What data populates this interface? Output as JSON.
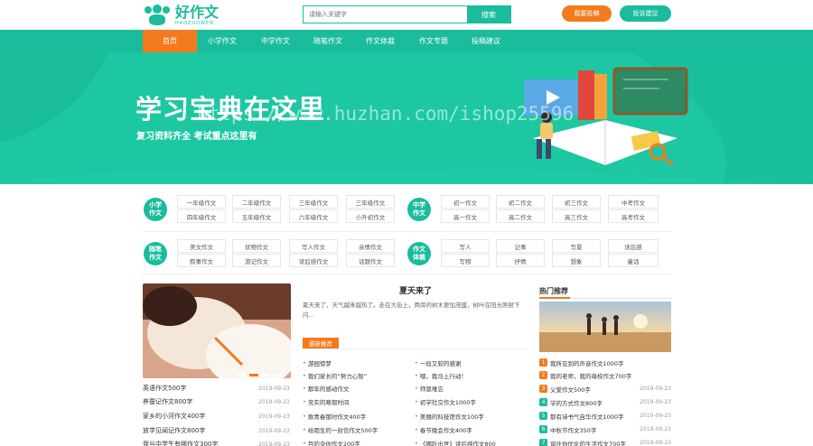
{
  "header": {
    "logo_cn": "好作文",
    "logo_en": "HAOZUOWEN",
    "search_placeholder": "请输入关键字",
    "search_button": "搜索",
    "submit_button": "我要投稿",
    "suggest_button": "投诉建议"
  },
  "nav": [
    "首页",
    "小学作文",
    "中学作文",
    "随笔作文",
    "作文体裁",
    "作文专题",
    "投稿建议"
  ],
  "banner": {
    "title": "学习宝典在这里",
    "subtitle": "复习资料齐全 考试重点这里有",
    "watermark": "https://www.huzhan.com/ishop25596"
  },
  "categories": {
    "primary": {
      "badge": "小学作文",
      "items": [
        "一年级作文",
        "二年级作文",
        "三年级作文",
        "三年级作文",
        "四年级作文",
        "五年级作文",
        "六年级作文",
        "小升初作文"
      ]
    },
    "middle": {
      "badge": "中学作文",
      "items": [
        "初一作文",
        "初二作文",
        "初三作文",
        "中考作文",
        "高一作文",
        "高二作文",
        "高三作文",
        "高考作文"
      ]
    },
    "essay": {
      "badge": "随笔作文",
      "items": [
        "美文作文",
        "状物作文",
        "写人作文",
        "亲情作文",
        "叙事作文",
        "游记作文",
        "读后感作文",
        "话题作文"
      ]
    },
    "genre": {
      "badge": "作文体裁",
      "items": [
        "写人",
        "记事",
        "写景",
        "读后感",
        "写物",
        "抒情",
        "想象",
        "童话"
      ]
    }
  },
  "left_list": [
    {
      "title": "英语作文500字",
      "date": "2019-09-23"
    },
    {
      "title": "养蚕记作文800字",
      "date": "2019-09-23"
    },
    {
      "title": "家乡的小河作文400字",
      "date": "2019-09-23"
    },
    {
      "title": "放学见闻记作文800字",
      "date": "2019-09-23"
    },
    {
      "title": "我与中学生有哪作文300字",
      "date": "2019-09-23"
    }
  ],
  "featured": {
    "title": "夏天来了",
    "desc": "夏天来了，天气越来越热了。走在大街上，两旁的树木更加茂盛，树叶在阳光照射下闪..."
  },
  "latest": {
    "tag": "最新推荐",
    "col1": [
      "游园惊梦",
      "我们家长的“努力心智”",
      "那年的感动作文",
      "充实的寒假时间",
      "致青春那时作文400字",
      "给陌生的一封信作文500字",
      "目的令你作文200字"
    ],
    "col2": [
      "一段又软的感谢",
      "嘿，我马上行动！",
      "师恩难忘",
      "初学社交作文1000字",
      "美丽的科技馆作文100字",
      "春节晚会作文400字",
      "《哪吒出世》读后感作文800"
    ]
  },
  "hot": {
    "title": "热门推荐",
    "items": [
      {
        "num": "1",
        "title": "我所见到的声音作文1000字",
        "date": ""
      },
      {
        "num": "2",
        "title": "我的老师，我的母校作文700字",
        "date": ""
      },
      {
        "num": "3",
        "title": "父爱作文500字",
        "date": "2019-09-23"
      },
      {
        "num": "4",
        "title": "学的方式作文800字",
        "date": "2019-09-23"
      },
      {
        "num": "5",
        "title": "那有诗书气自华作文1000字",
        "date": "2019-09-23"
      },
      {
        "num": "6",
        "title": "中秋节作文350字",
        "date": "2019-09-23"
      },
      {
        "num": "7",
        "title": "留住你优化的生活作文700字",
        "date": "2019-09-23"
      }
    ]
  }
}
